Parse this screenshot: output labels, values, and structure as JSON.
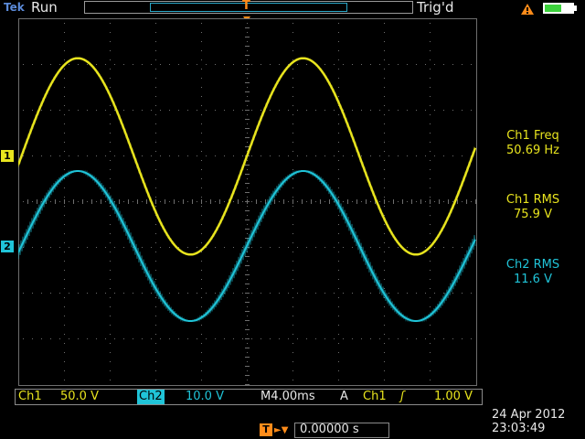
{
  "topbar": {
    "brand": "Tek",
    "run_status": "Run",
    "trigger_status": "Trig'd",
    "record_trigger_glyph": "T"
  },
  "markers": {
    "trigger_position": "T",
    "ch1": "1",
    "ch2": "2"
  },
  "colors": {
    "ch1": "#e8e41e",
    "ch2": "#20c4d8",
    "trigger": "#ff8c1a",
    "grid": "#6e6e6e",
    "battery": "#3cd23c"
  },
  "icons": [
    "warning-icon",
    "battery-icon"
  ],
  "measurements": [
    {
      "label": "Ch1 Freq",
      "value": "50.69 Hz"
    },
    {
      "label": "Ch1 RMS",
      "value": "75.9 V"
    },
    {
      "label": "Ch2 RMS",
      "value": "11.6 V"
    }
  ],
  "bottom": {
    "ch1_label": "Ch1",
    "ch1_scale": "50.0 V",
    "ch2_label": "Ch2",
    "ch2_scale": "10.0 V",
    "timebase": "M4.00ms",
    "trigger_mode": "A",
    "trigger_source": "Ch1",
    "trigger_slope": "ʃ",
    "trigger_level": "1.00 V",
    "delay_value": "0.00000 s"
  },
  "datetime": {
    "date": "24 Apr  2012",
    "time": "23:03:49"
  },
  "waveforms": {
    "frequency_hz": 50.69,
    "ch1": {
      "rms_v": 75.9,
      "volts_per_div": 50.0
    },
    "ch2": {
      "rms_v": 11.6,
      "volts_per_div": 10.0
    },
    "time_per_div_ms": 4.0
  }
}
